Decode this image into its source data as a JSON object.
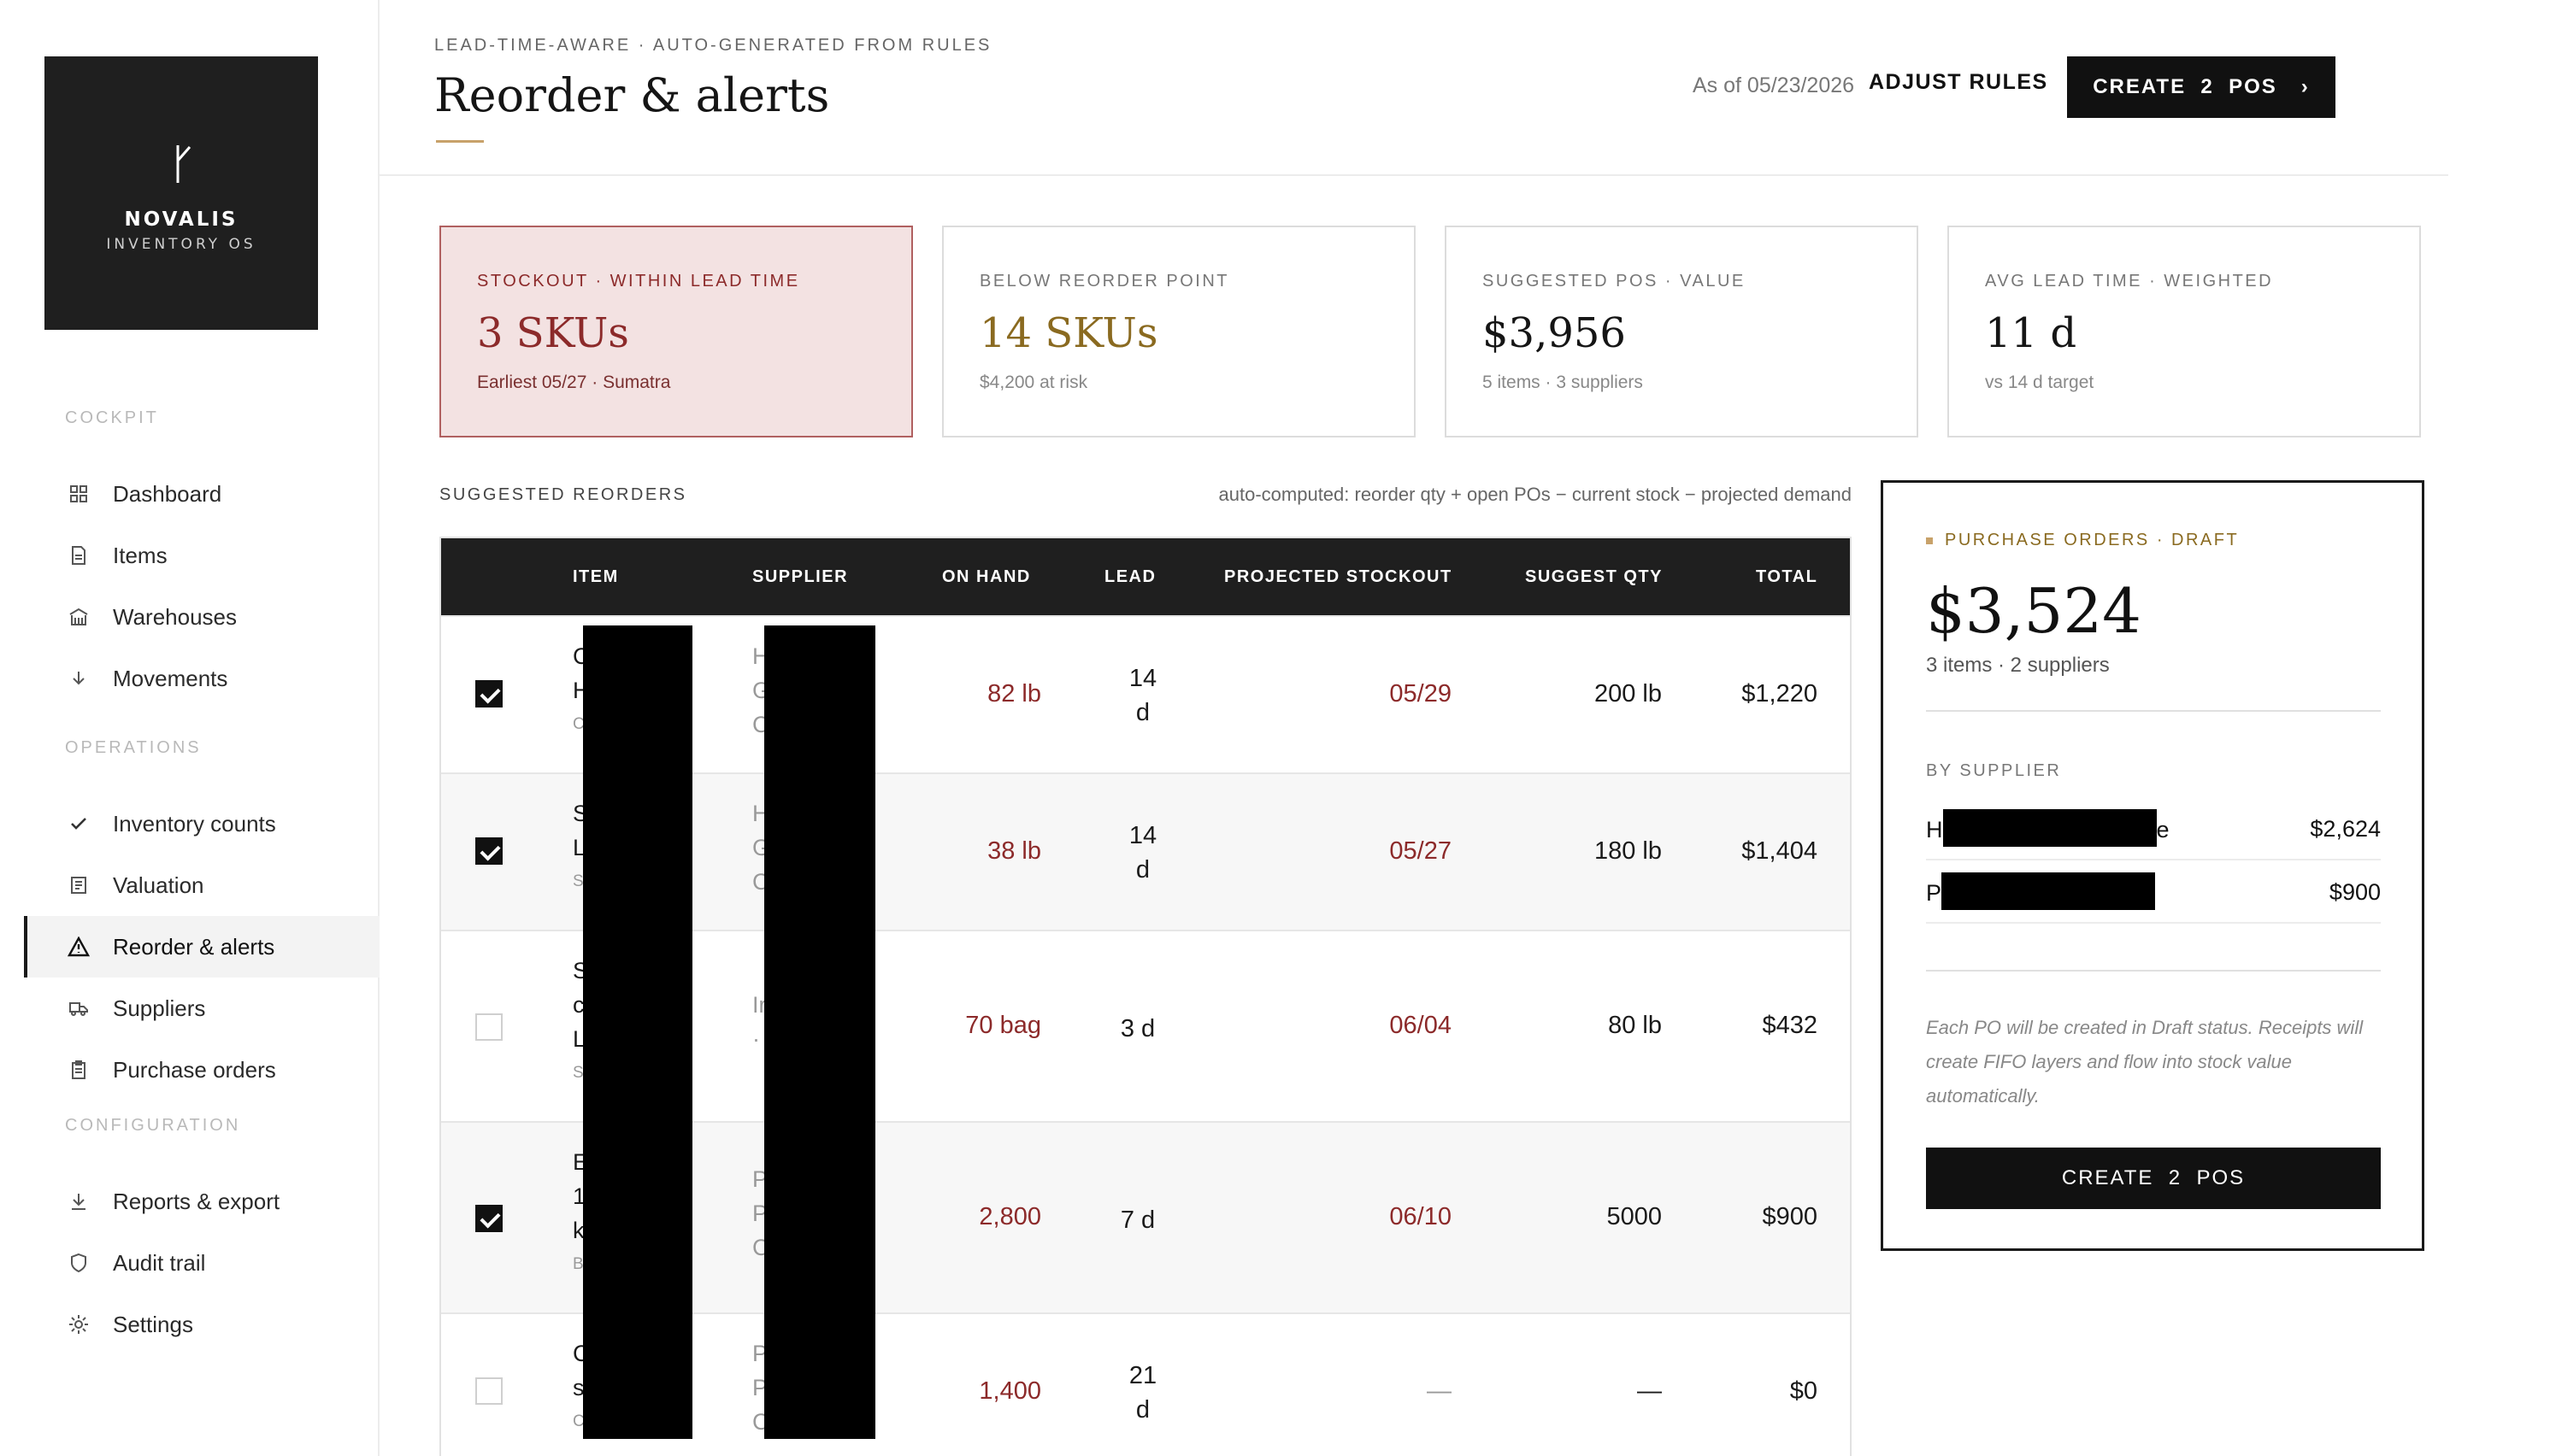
{
  "brand": {
    "name": "NOVALIS",
    "sub": "INVENTORY OS"
  },
  "sidebar": {
    "sections": [
      {
        "label": "COCKPIT",
        "items": [
          {
            "label": "Dashboard",
            "icon": "grid-icon"
          },
          {
            "label": "Items",
            "icon": "document-icon"
          },
          {
            "label": "Warehouses",
            "icon": "building-icon"
          },
          {
            "label": "Movements",
            "icon": "arrow-down-icon"
          }
        ]
      },
      {
        "label": "OPERATIONS",
        "items": [
          {
            "label": "Inventory counts",
            "icon": "check-icon"
          },
          {
            "label": "Valuation",
            "icon": "ledger-icon"
          },
          {
            "label": "Reorder & alerts",
            "icon": "warning-icon",
            "active": true
          },
          {
            "label": "Suppliers",
            "icon": "truck-icon"
          },
          {
            "label": "Purchase orders",
            "icon": "clipboard-icon"
          }
        ]
      },
      {
        "label": "CONFIGURATION",
        "items": [
          {
            "label": "Reports & export",
            "icon": "download-icon"
          },
          {
            "label": "Audit trail",
            "icon": "shield-icon"
          },
          {
            "label": "Settings",
            "icon": "gear-icon"
          }
        ]
      }
    ]
  },
  "header": {
    "eyebrow": "LEAD-TIME-AWARE · AUTO-GENERATED FROM RULES",
    "title": "Reorder & alerts",
    "as_of": "As of 05/23/2026",
    "adjust_label": "ADJUST RULES",
    "create_label": "CREATE  2  POS",
    "create_chevron": "›"
  },
  "kpis": [
    {
      "label": "STOCKOUT · WITHIN LEAD TIME",
      "value": "3 SKUs",
      "sub": "Earliest 05/27 · Sumatra",
      "tone": "alert"
    },
    {
      "label": "BELOW REORDER POINT",
      "value": "14 SKUs",
      "sub": "$4,200 at risk",
      "tone": "warn"
    },
    {
      "label": "SUGGESTED POS · VALUE",
      "value": "$3,956",
      "sub": "5 items · 3 suppliers",
      "tone": "normal"
    },
    {
      "label": "AVG LEAD TIME · WEIGHTED",
      "value": "11 d",
      "sub": "vs 14 d target",
      "tone": "normal"
    }
  ],
  "reorders": {
    "section_label": "SUGGESTED REORDERS",
    "formula": "auto-computed: reorder qty + open POs − current stock − projected demand",
    "columns": [
      "ITEM",
      "SUPPLIER",
      "ON HAND",
      "LEAD",
      "PROJECTED STOCKOUT",
      "SUGGEST QTY",
      "TOTAL"
    ],
    "rows": [
      {
        "checked": true,
        "item": [
          "C",
          "H",
          "C"
        ],
        "supplier": [
          "H",
          "G",
          "C"
        ],
        "on_hand": "82 lb",
        "lead": [
          "14",
          "d"
        ],
        "stockout": "05/29",
        "qty": "200 lb",
        "total": "$1,220"
      },
      {
        "checked": true,
        "item": [
          "S",
          "L",
          "S"
        ],
        "supplier": [
          "H",
          "G",
          "C"
        ],
        "on_hand": "38 lb",
        "lead": [
          "14",
          "d"
        ],
        "stockout": "05/27",
        "qty": "180 lb",
        "total": "$1,404"
      },
      {
        "checked": false,
        "item": [
          "S",
          "c",
          "L",
          "S"
        ],
        "supplier": [
          "Ir",
          "·"
        ],
        "on_hand": "70 bag",
        "lead": [
          "3 d"
        ],
        "stockout": "06/04",
        "qty": "80 lb",
        "total": "$432"
      },
      {
        "checked": true,
        "item": [
          "E",
          "1",
          "k",
          "B"
        ],
        "supplier": [
          "P",
          "P",
          "C"
        ],
        "on_hand": "2,800",
        "lead": [
          "7 d"
        ],
        "stockout": "06/10",
        "qty": "5000",
        "total": "$900"
      },
      {
        "checked": false,
        "item": [
          "C",
          "s",
          "C"
        ],
        "supplier": [
          "P",
          "P",
          "C"
        ],
        "on_hand": "1,400",
        "lead": [
          "21",
          "d"
        ],
        "stockout": "—",
        "qty": "—",
        "total": "$0"
      }
    ]
  },
  "po_panel": {
    "label": "PURCHASE ORDERS · DRAFT",
    "value": "$3,524",
    "sub": "3 items · 2 suppliers",
    "by_label": "BY SUPPLIER",
    "suppliers": [
      {
        "name_start": "H",
        "name_end": "e",
        "amount": "$2,624"
      },
      {
        "name_start": "P",
        "name_end": "",
        "amount": "$900"
      }
    ],
    "note": "Each PO will be created in Draft status. Receipts will create FIFO layers and flow into stock value automatically.",
    "create_label": "CREATE  2  POS"
  },
  "colors": {
    "alert": "#8c2a2a",
    "warn": "#8a6a20",
    "accent": "#c8a26a",
    "ink": "#111111"
  }
}
